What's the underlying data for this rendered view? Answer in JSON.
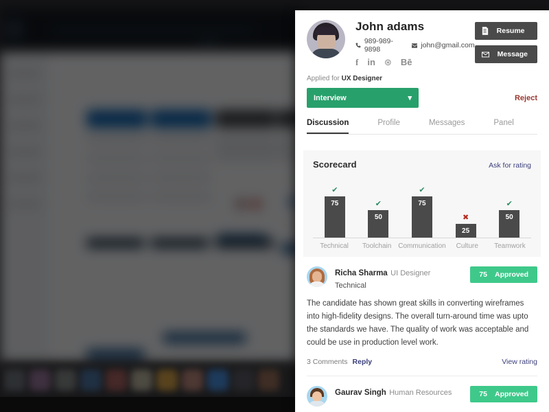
{
  "background": {
    "kind": "blurred-desktop",
    "dock_icon_colors": [
      "#5a5f66",
      "#7b5f7e",
      "#6d6f70",
      "#3f5f86",
      "#8a4f4f",
      "#9a9482",
      "#b0853c",
      "#9b6f66",
      "#3b74b5",
      "#4a4a52",
      "#7c5a48"
    ]
  },
  "panel": {
    "candidate": {
      "name": "John adams",
      "phone": "989-989-9898",
      "email": "john@gmail.com",
      "avatar_name": "candidate-avatar",
      "socials": [
        {
          "name": "facebook-icon",
          "glyph": "f"
        },
        {
          "name": "linkedin-icon",
          "glyph": "in"
        },
        {
          "name": "dribbble-icon",
          "glyph": "⊛"
        },
        {
          "name": "behance-icon",
          "glyph": "Bē"
        }
      ]
    },
    "actions": {
      "resume_label": "Resume",
      "message_label": "Message",
      "resume_icon": "document-icon",
      "message_icon": "envelope-icon"
    },
    "applied": {
      "prefix": "Applied for",
      "role": "UX Designer"
    },
    "status": {
      "value": "Interview",
      "chevron": "▾",
      "reject_label": "Reject",
      "color": "#28a06c",
      "reject_color": "#9a362f"
    },
    "tabs": [
      {
        "label": "Discussion",
        "active": true
      },
      {
        "label": "Profile",
        "active": false
      },
      {
        "label": "Messages",
        "active": false
      },
      {
        "label": "Panel",
        "active": false
      }
    ],
    "scorecard": {
      "title": "Scorecard",
      "link_label": "Ask for rating"
    },
    "comments": [
      {
        "name": "Richa Sharma",
        "role": "UI Designer",
        "category": "Technical",
        "score": "75",
        "status": "Approved",
        "avatar_name": "commenter-avatar-richa-sharma",
        "text": "The candidate has shown great skills in converting wireframes into high-fidelity designs. The overall turn-around time was upto the standards we have. The quality of work was acceptable and could be use in production level work.",
        "comments_count": "3 Comments",
        "reply_label": "Reply",
        "view_rating_label": "View rating"
      },
      {
        "name": "Gaurav Singh",
        "role": "Human Resources",
        "category": "",
        "score": "75",
        "status": "Approved",
        "avatar_name": "commenter-avatar-gaurav-singh",
        "text": "",
        "comments_count": "",
        "reply_label": "",
        "view_rating_label": ""
      }
    ]
  },
  "chart_data": {
    "type": "bar",
    "title": "Scorecard",
    "categories": [
      "Technical",
      "Toolchain",
      "Communication",
      "Culture",
      "Teamwork"
    ],
    "values": [
      75,
      50,
      75,
      25,
      50
    ],
    "marks": [
      "check",
      "check",
      "check",
      "cross",
      "check"
    ],
    "xlabel": "",
    "ylabel": "",
    "ylim": [
      0,
      100
    ],
    "grid": false,
    "legend": "none",
    "bar_color": "#4a4a4a",
    "value_label_color": "#ffffff",
    "check_color": "#2e8b63",
    "cross_color": "#b32d23"
  }
}
